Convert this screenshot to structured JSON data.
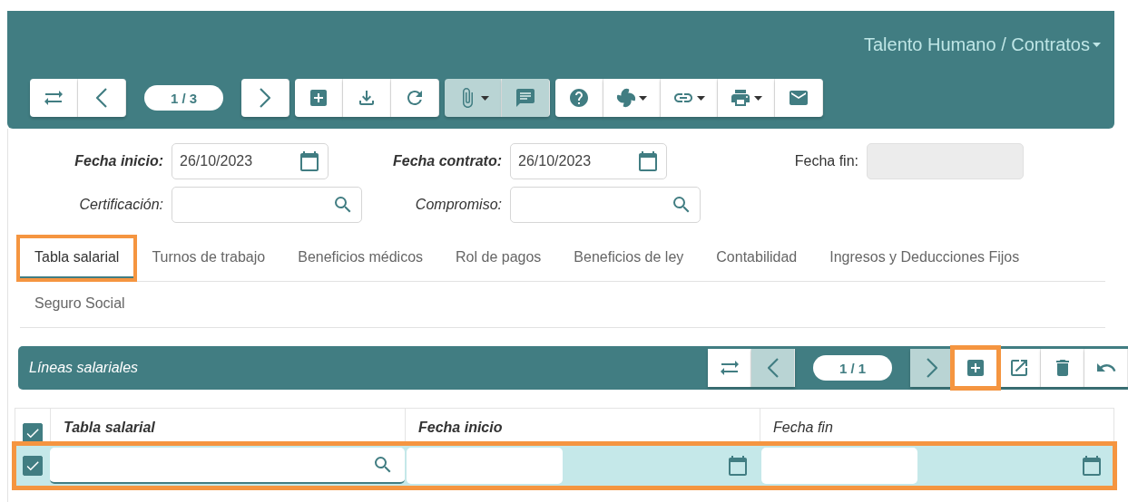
{
  "header": {
    "title": "Talento Humano / Contratos",
    "toolbar": [
      {
        "kind": "swap",
        "disabled": false,
        "pressed": false,
        "dropdown": false
      },
      {
        "kind": "prev",
        "disabled": false,
        "pressed": false,
        "dropdown": false
      },
      {
        "kind": "pager",
        "text": "1 / 3"
      },
      {
        "kind": "next",
        "disabled": false,
        "pressed": false,
        "dropdown": false
      },
      {
        "kind": "gap"
      },
      {
        "kind": "add",
        "disabled": false,
        "pressed": false,
        "dropdown": false
      },
      {
        "kind": "download",
        "disabled": false,
        "pressed": false,
        "dropdown": false
      },
      {
        "kind": "refresh",
        "disabled": false,
        "pressed": false,
        "dropdown": false
      },
      {
        "kind": "gap"
      },
      {
        "kind": "attach",
        "disabled": false,
        "pressed": true,
        "dropdown": true
      },
      {
        "kind": "comment",
        "disabled": false,
        "pressed": true,
        "dropdown": false
      },
      {
        "kind": "gap"
      },
      {
        "kind": "help",
        "disabled": false,
        "pressed": false,
        "dropdown": false
      },
      {
        "kind": "fan",
        "disabled": false,
        "pressed": false,
        "dropdown": true
      },
      {
        "kind": "link",
        "disabled": false,
        "pressed": false,
        "dropdown": true
      },
      {
        "kind": "print",
        "disabled": false,
        "pressed": false,
        "dropdown": true
      },
      {
        "kind": "mail",
        "disabled": false,
        "pressed": false,
        "dropdown": false
      }
    ]
  },
  "form": [
    [
      {
        "label": "Fecha inicio:",
        "bold": true,
        "kind": "date",
        "value": "26/10/2023"
      },
      {
        "label": "Fecha contrato:",
        "bold": true,
        "kind": "date",
        "value": "26/10/2023"
      },
      {
        "label": "Fecha fin:",
        "bold": false,
        "kind": "readonly"
      }
    ],
    [
      {
        "label": "Certificación:",
        "bold": false,
        "italic": true,
        "kind": "lookup"
      },
      {
        "label": "Compromiso:",
        "bold": false,
        "italic": true,
        "kind": "lookup"
      }
    ]
  ],
  "tabs": [
    {
      "label": "Tabla salarial",
      "selected": true,
      "highlighted": true
    },
    {
      "label": "Turnos de trabajo",
      "selected": false,
      "highlighted": false
    },
    {
      "label": "Beneficios médicos",
      "selected": false,
      "highlighted": false
    },
    {
      "label": "Rol de pagos",
      "selected": false,
      "highlighted": false
    },
    {
      "label": "Beneficios de ley",
      "selected": false,
      "highlighted": false
    },
    {
      "label": "Contabilidad",
      "selected": false,
      "highlighted": false
    },
    {
      "label": "Ingresos y Deducciones Fijos",
      "selected": false,
      "highlighted": false
    },
    {
      "label": "Seguro Social",
      "selected": false,
      "highlighted": false
    }
  ],
  "panel": {
    "title": "Líneas salariales",
    "toolbar": [
      {
        "kind": "swap",
        "disabled": false,
        "highlighted": false
      },
      {
        "kind": "prev",
        "disabled": true,
        "highlighted": false
      },
      {
        "kind": "pager",
        "text": "1 / 1"
      },
      {
        "kind": "next",
        "disabled": true,
        "highlighted": false
      },
      {
        "kind": "add",
        "disabled": false,
        "highlighted": true
      },
      {
        "kind": "open",
        "disabled": false,
        "highlighted": false
      },
      {
        "kind": "delete",
        "disabled": false,
        "highlighted": false
      },
      {
        "kind": "undo",
        "disabled": false,
        "highlighted": false
      }
    ]
  },
  "table": {
    "select_all": {
      "checked": true
    },
    "columns": [
      {
        "label": "Tabla salarial",
        "bold": true
      },
      {
        "label": "Fecha inicio",
        "bold": true
      },
      {
        "label": "Fecha fin",
        "bold": false
      }
    ],
    "rows": [
      {
        "checked": true,
        "highlighted": true,
        "cells": [
          {
            "kind": "lookup"
          },
          {
            "kind": "date"
          },
          {
            "kind": "date"
          }
        ]
      }
    ]
  }
}
